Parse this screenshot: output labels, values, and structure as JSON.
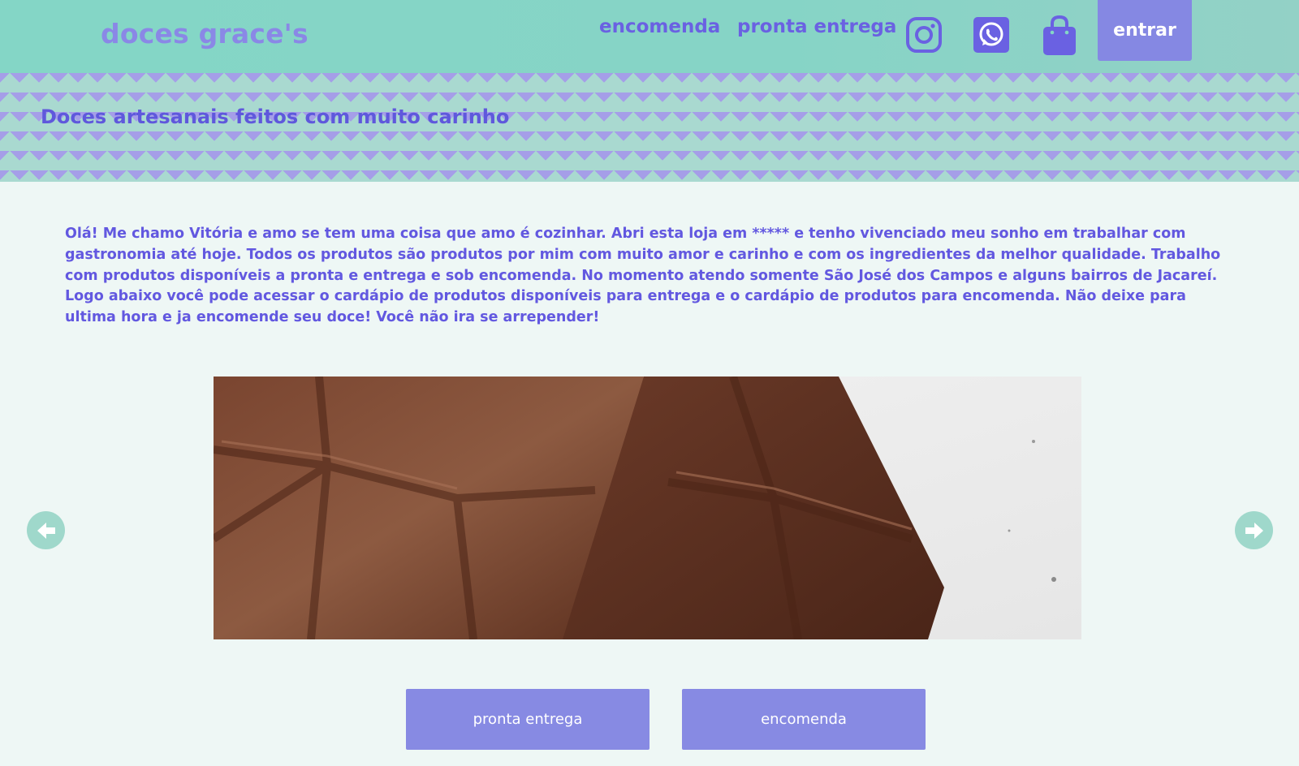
{
  "header": {
    "brand": "doces grace's",
    "nav": {
      "encomenda": "encomenda",
      "pronta_entrega": "pronta entrega"
    },
    "icons": [
      "instagram-icon",
      "whatsapp-icon",
      "shopping-bag-icon"
    ],
    "login_label": "entrar"
  },
  "banner": {
    "tagline": "Doces artesanais feitos com muito carinho"
  },
  "intro": {
    "text": "Olá! Me chamo Vitória e amo se tem uma coisa que amo é cozinhar. Abri esta loja em ***** e tenho vivenciado meu sonho em trabalhar com gastronomia até hoje. Todos os produtos são produtos por mim com muito amor e carinho e com os ingredientes da melhor qualidade. Trabalho com produtos disponíveis a pronta e entrega e sob encomenda. No momento atendo somente São José dos Campos e alguns bairros de Jacareí. Logo abaixo você pode acessar o cardápio de produtos disponíveis para entrega e o cardápio de produtos para encomenda. Não deixe para ultima hora e ja encomende seu doce! Você não ira se arrepender!"
  },
  "carousel": {
    "prev_icon": "arrow-left-icon",
    "next_icon": "arrow-right-icon"
  },
  "actions": {
    "pronta_entrega": "pronta entrega",
    "encomenda": "encomenda"
  },
  "colors": {
    "header_bg": "#84d6c6",
    "accent": "#8588e3",
    "text_primary": "#6258e0",
    "page_bg": "#eef7f5"
  }
}
